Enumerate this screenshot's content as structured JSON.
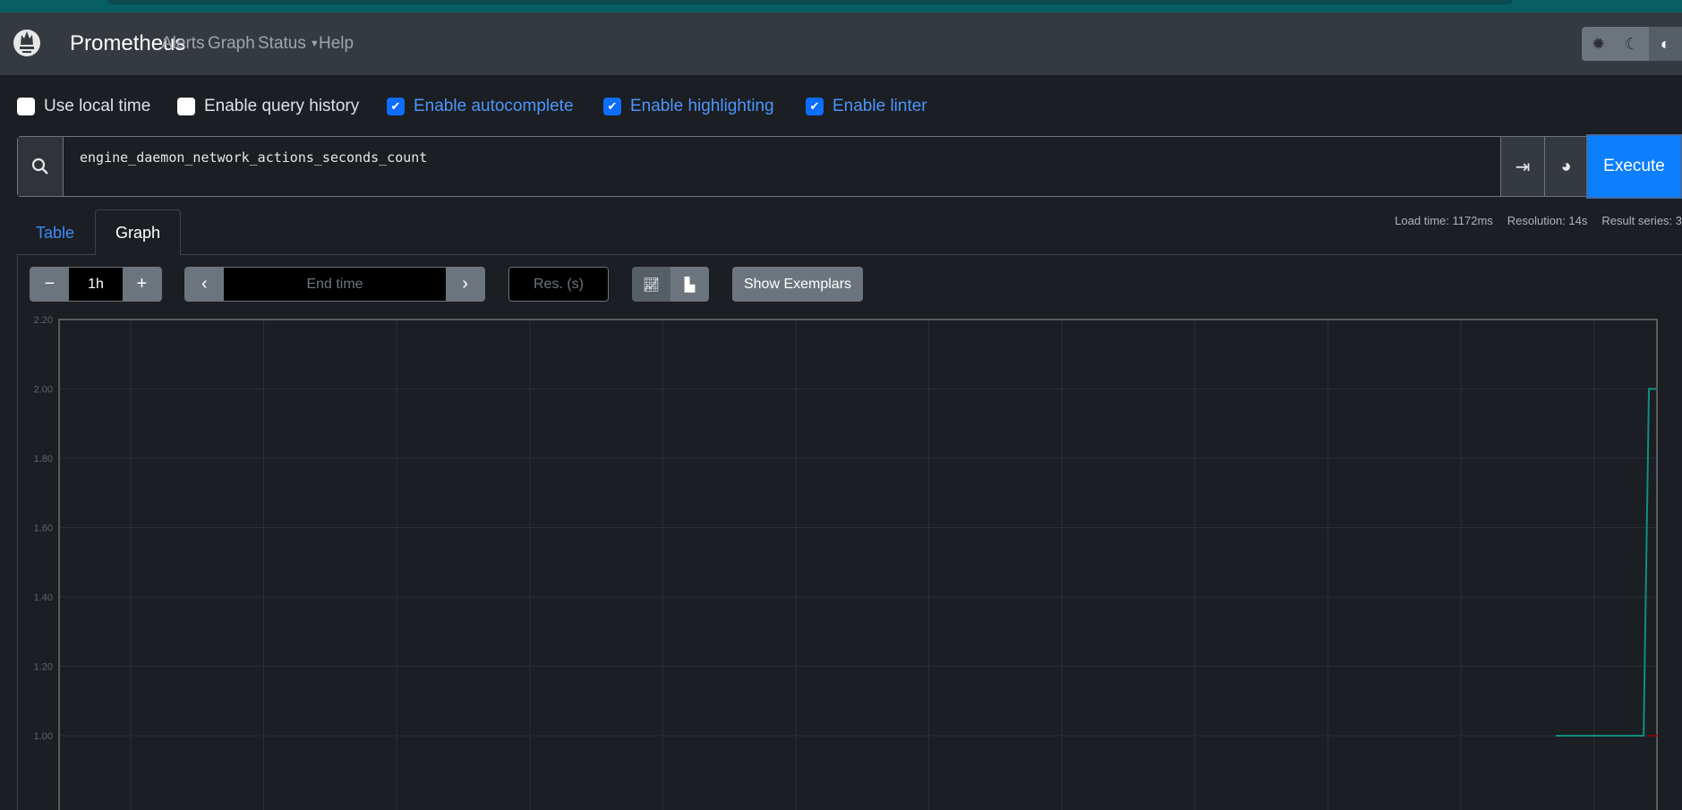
{
  "nav": {
    "brand": "Prometheus",
    "links": [
      "Alerts",
      "Graph",
      "Status",
      "Help"
    ],
    "theme_buttons": [
      "sun-icon",
      "moon-icon",
      "half-circle-icon"
    ]
  },
  "options": [
    {
      "label": "Use local time",
      "checked": false
    },
    {
      "label": "Enable query history",
      "checked": false
    },
    {
      "label": "Enable autocomplete",
      "checked": true
    },
    {
      "label": "Enable highlighting",
      "checked": true
    },
    {
      "label": "Enable linter",
      "checked": true
    }
  ],
  "query": {
    "value": "engine_daemon_network_actions_seconds_count",
    "execute_label": "Execute"
  },
  "stats": {
    "load_time": "Load time: 1172ms",
    "resolution": "Resolution: 14s",
    "result_series": "Result series: 3"
  },
  "tabs": [
    "Table",
    "Graph"
  ],
  "active_tab": "Graph",
  "controls": {
    "range": "1h",
    "end_time_placeholder": "End time",
    "resolution_placeholder": "Res. (s)",
    "show_exemplars": "Show Exemplars"
  },
  "colors": {
    "accent": "#0d7ffd",
    "series1": "#0f8f80",
    "series2": "#8b0000"
  },
  "chart_data": {
    "type": "line",
    "range": "1h",
    "ylim": [
      1.0,
      2.2
    ],
    "yticks": [
      "2.20",
      "2.00",
      "1.80",
      "1.60",
      "1.40",
      "1.20",
      "1.00"
    ],
    "grid": true,
    "x_unit": "minutes into range",
    "series": [
      {
        "color": "#0f8f80",
        "points": [
          [
            56.2,
            1
          ],
          [
            59.5,
            1
          ],
          [
            59.7,
            2
          ],
          [
            60,
            2
          ]
        ]
      },
      {
        "color": "#8b0000",
        "points": [
          [
            59.7,
            1
          ],
          [
            60,
            1
          ]
        ]
      }
    ]
  }
}
